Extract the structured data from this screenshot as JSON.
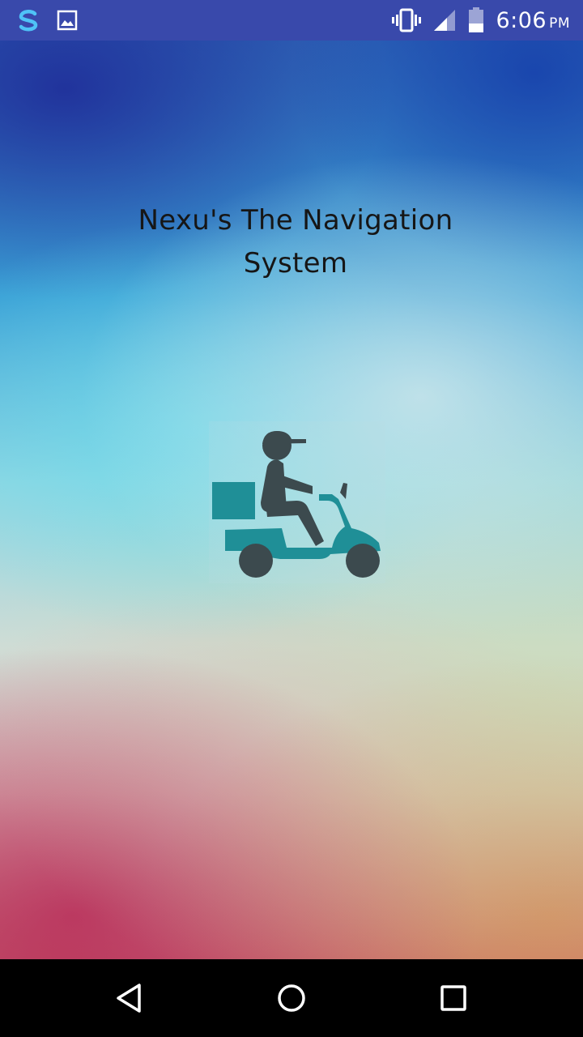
{
  "status_bar": {
    "time": "6:06",
    "ampm": "PM",
    "background_color": "#3949ab",
    "left_icons": [
      "swipe-app-s-icon",
      "gallery-image-icon"
    ],
    "right_icons": [
      "vibrate-icon",
      "cell-signal-icon",
      "battery-icon"
    ]
  },
  "app": {
    "title_line1": "Nexu's The Navigation",
    "title_line2": "System",
    "logo_icon": "scooter-delivery-rider-icon",
    "logo_colors": {
      "rider": "#3c4a4e",
      "scooter": "#1f8f97",
      "box": "#1f8f97"
    }
  },
  "nav_bar": {
    "buttons": [
      "back-icon",
      "home-icon",
      "recents-icon"
    ]
  }
}
